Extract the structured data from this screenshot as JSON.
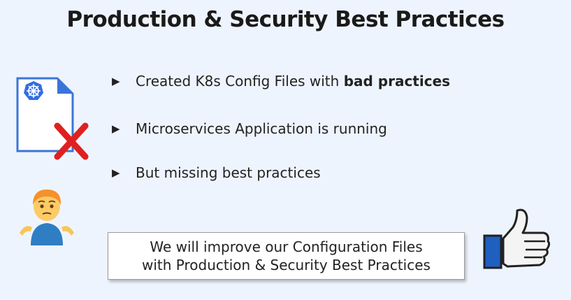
{
  "title": "Production & Security Best Practices",
  "bullets": [
    {
      "text": "Created K8s Config Files with ",
      "bold": "bad practices"
    },
    {
      "text": "Microservices Application is running",
      "bold": ""
    },
    {
      "text": "But missing best practices",
      "bold": ""
    }
  ],
  "bullet_marker": "▶",
  "callout": {
    "line1": "We will improve our Configuration Files",
    "line2": "with Production & Security Best Practices"
  },
  "colors": {
    "background": "#eef4fd",
    "kubernetes_blue": "#326ce5",
    "cross_red": "#e02020",
    "thumb_blue": "#1f5fbf"
  },
  "icons": [
    "kubernetes-file-icon",
    "red-x-icon",
    "shrugging-person-icon",
    "thumbs-up-icon"
  ]
}
